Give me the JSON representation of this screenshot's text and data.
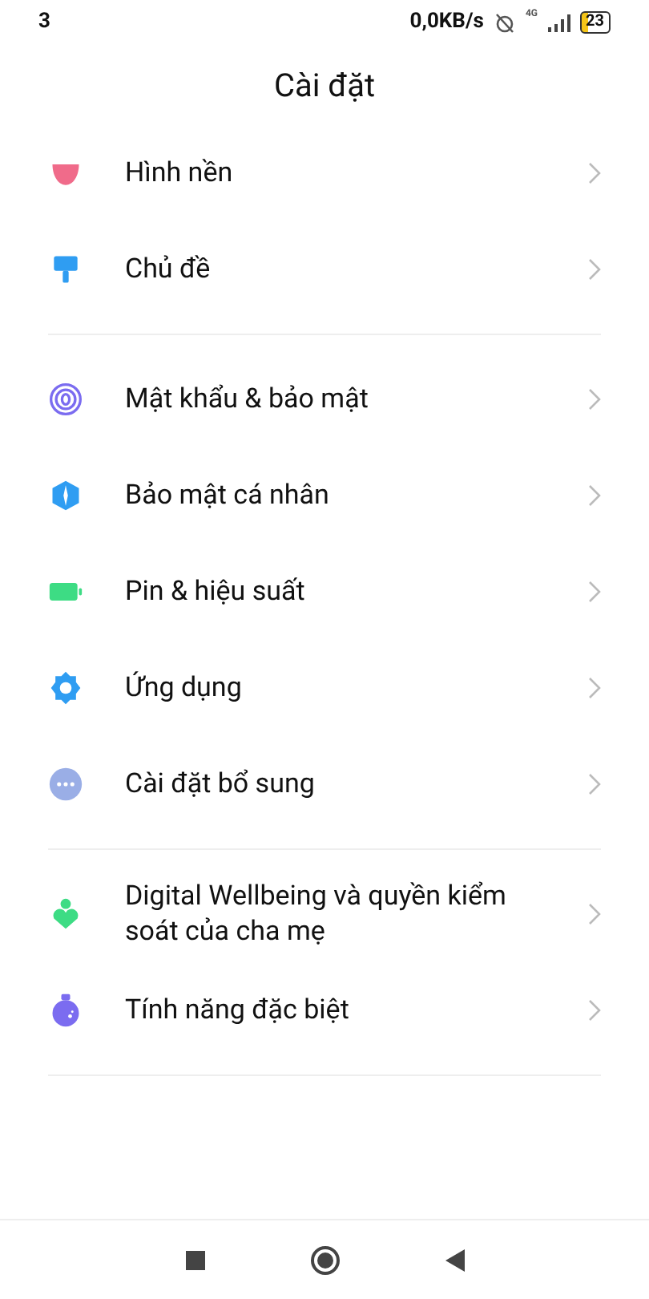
{
  "status_bar": {
    "time": "3",
    "speed": "0,0KB/s",
    "network": "4G",
    "battery": "23"
  },
  "header": {
    "title": "Cài đặt"
  },
  "sections": [
    {
      "items": [
        {
          "label": "Hình nền",
          "kind": "wallpaper",
          "color": "#f06b8a"
        },
        {
          "label": "Chủ đề",
          "kind": "theme",
          "color": "#2f9df2"
        }
      ]
    },
    {
      "items": [
        {
          "label": "Mật khẩu & bảo mật",
          "kind": "fingerprint",
          "color": "#7b6cf0"
        },
        {
          "label": "Bảo mật cá nhân",
          "kind": "shield",
          "color": "#2f9df2"
        },
        {
          "label": "Pin & hiệu suất",
          "kind": "battery",
          "color": "#3ddc84"
        },
        {
          "label": "Ứng dụng",
          "kind": "gear",
          "color": "#2f9df2"
        },
        {
          "label": "Cài đặt bổ sung",
          "kind": "more",
          "color": "#9aaee6"
        }
      ]
    },
    {
      "items": [
        {
          "label": "Digital Wellbeing và quyền kiểm soát của cha mẹ",
          "kind": "wellbeing",
          "color": "#3ddc84"
        },
        {
          "label": "Tính năng đặc biệt",
          "kind": "flask",
          "color": "#7b6cf0"
        }
      ]
    }
  ]
}
